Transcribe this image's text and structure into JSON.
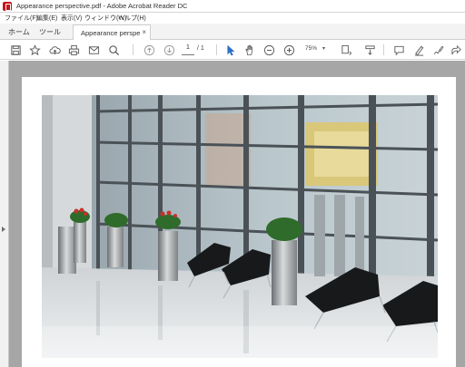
{
  "window": {
    "title": "Appearance perspective.pdf - Adobe Acrobat Reader DC"
  },
  "menu": {
    "items": [
      "ファイル(F)",
      "編集(E)",
      "表示(V)",
      "ウィンドウ(W)",
      "ヘルプ(H)"
    ]
  },
  "tabs": {
    "home": "ホーム",
    "tools": "ツール",
    "document": "Appearance perspe...",
    "close_glyph": "×"
  },
  "toolbar": {
    "current_page": "1",
    "page_total": "/ 1",
    "zoom": "75%",
    "zoom_caret": "▾"
  },
  "colors": {
    "acrobat_red": "#c4161c",
    "toolbar_icon": "#5a5a5a",
    "canvas_gray": "#a6a6a6"
  }
}
